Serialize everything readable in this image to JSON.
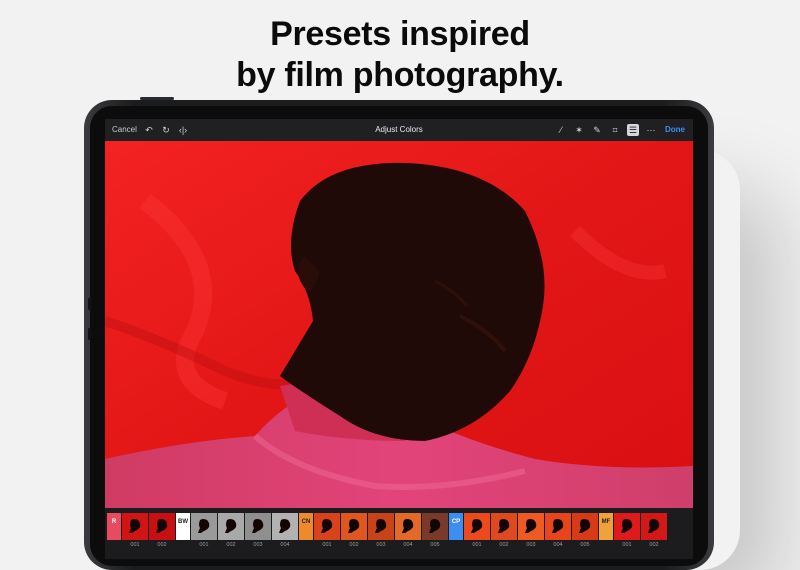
{
  "headline": {
    "line1": "Presets inspired",
    "line2": "by film photography."
  },
  "toolbar": {
    "cancel_label": "Cancel",
    "title": "Adjust Colors",
    "done_label": "Done",
    "left_icons": [
      "undo-icon",
      "redo-icon",
      "compare-icon"
    ],
    "right_icons": [
      "brush-icon",
      "magic-wand-icon",
      "pencil-icon",
      "crop-icon",
      "adjust-colors-icon",
      "more-icon"
    ],
    "active_icon": "adjust-colors-icon"
  },
  "presets": [
    {
      "type": "label",
      "text": "R",
      "color": "#e84a5f"
    },
    {
      "type": "thumb",
      "num": "001",
      "color": "#d11414"
    },
    {
      "type": "thumb",
      "num": "002",
      "color": "#c90f12"
    },
    {
      "type": "label",
      "text": "BW",
      "color": "#ffffff"
    },
    {
      "type": "thumb",
      "num": "001",
      "color": "#9a9a9a"
    },
    {
      "type": "thumb",
      "num": "002",
      "color": "#a9a9a9"
    },
    {
      "type": "thumb",
      "num": "003",
      "color": "#8f8f8f"
    },
    {
      "type": "thumb",
      "num": "004",
      "color": "#b2b2b2"
    },
    {
      "type": "label",
      "text": "CN",
      "color": "#ef8a2c"
    },
    {
      "type": "thumb",
      "num": "001",
      "color": "#d8431c"
    },
    {
      "type": "thumb",
      "num": "002",
      "color": "#e0561f"
    },
    {
      "type": "thumb",
      "num": "003",
      "color": "#c84418"
    },
    {
      "type": "thumb",
      "num": "004",
      "color": "#e36a26"
    },
    {
      "type": "thumb",
      "num": "005",
      "color": "#7a3a2a"
    },
    {
      "type": "label",
      "text": "CP",
      "color": "#3d8ef0"
    },
    {
      "type": "thumb",
      "num": "001",
      "color": "#ec4a1c"
    },
    {
      "type": "thumb",
      "num": "002",
      "color": "#e0481e"
    },
    {
      "type": "thumb",
      "num": "003",
      "color": "#ee5a22"
    },
    {
      "type": "thumb",
      "num": "004",
      "color": "#e8451a"
    },
    {
      "type": "thumb",
      "num": "005",
      "color": "#d73a16"
    },
    {
      "type": "label",
      "text": "MF",
      "color": "#f0a23a"
    },
    {
      "type": "thumb",
      "num": "001",
      "color": "#df1a1c"
    },
    {
      "type": "thumb",
      "num": "002",
      "color": "#d31818"
    }
  ],
  "colors": {
    "accent": "#3d8ef0",
    "background": "#e31212"
  }
}
